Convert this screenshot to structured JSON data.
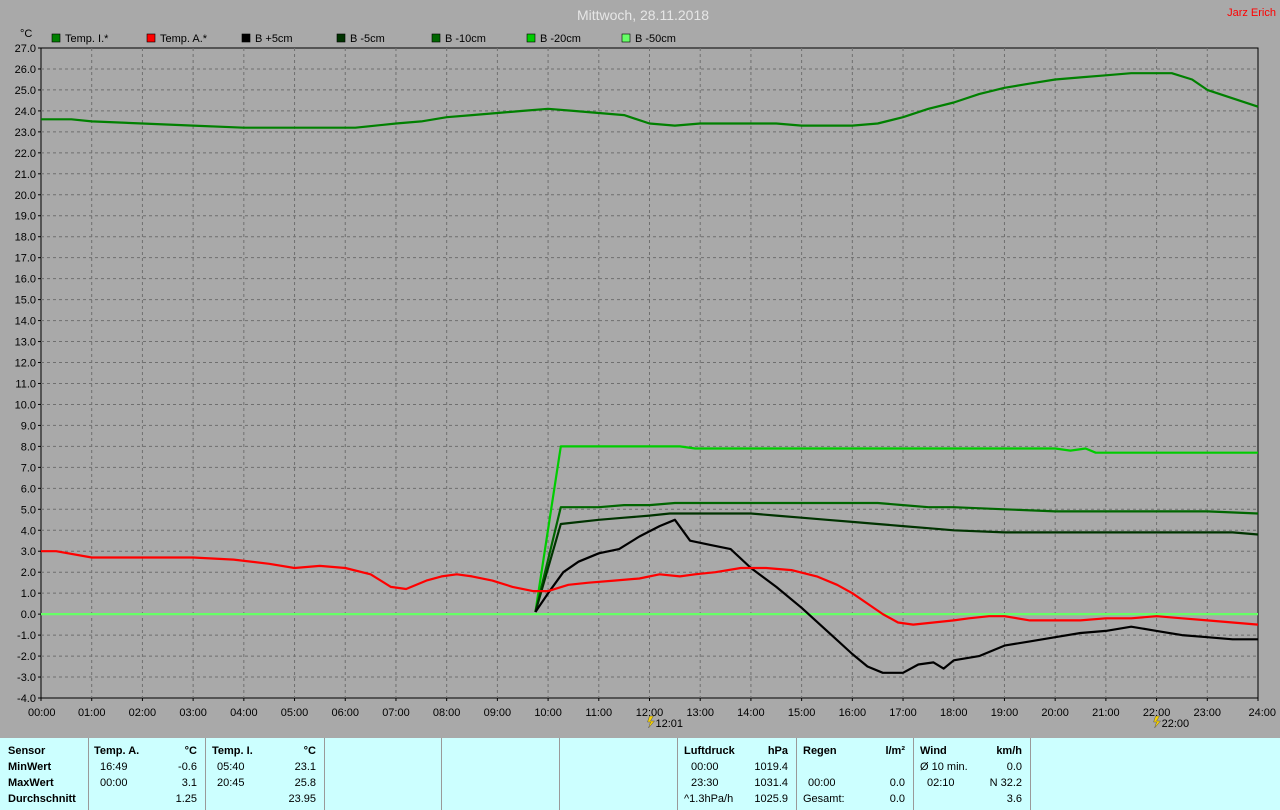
{
  "chart_data": {
    "type": "line",
    "title": "Mittwoch, 28.11.2018",
    "author": "Jarz Erich",
    "ylabel": "°C",
    "ylim": [
      -4,
      27
    ],
    "ytick_step": 1,
    "xlim": [
      0,
      24
    ],
    "x_ticks": [
      "00:00",
      "01:00",
      "02:00",
      "03:00",
      "04:00",
      "05:00",
      "06:00",
      "07:00",
      "08:00",
      "09:00",
      "10:00",
      "11:00",
      "12:00",
      "13:00",
      "14:00",
      "15:00",
      "16:00",
      "17:00",
      "18:00",
      "19:00",
      "20:00",
      "21:00",
      "22:00",
      "23:00",
      "24:00"
    ],
    "grid": true,
    "legend_position": "top",
    "markers": [
      {
        "x": 12.02,
        "label": "12:01",
        "icon": "lightning-icon"
      },
      {
        "x": 22.0,
        "label": "22:00",
        "icon": "lightning-icon"
      }
    ],
    "series": [
      {
        "name": "Temp. I.*",
        "color": "#008000",
        "x": [
          0,
          0.6,
          1,
          2,
          3,
          4,
          5,
          5.8,
          6.2,
          7,
          7.5,
          8,
          8.5,
          9,
          9.5,
          10,
          10.5,
          11,
          11.5,
          12,
          12.5,
          13,
          13.5,
          14,
          14.5,
          15,
          15.5,
          16,
          16.5,
          17,
          17.5,
          18,
          18.5,
          19,
          19.5,
          20,
          20.5,
          21,
          21.5,
          22,
          22.3,
          22.7,
          23,
          23.5,
          24
        ],
        "y": [
          23.6,
          23.6,
          23.5,
          23.4,
          23.3,
          23.2,
          23.2,
          23.2,
          23.2,
          23.4,
          23.5,
          23.7,
          23.8,
          23.9,
          24.0,
          24.1,
          24.0,
          23.9,
          23.8,
          23.4,
          23.3,
          23.4,
          23.4,
          23.4,
          23.4,
          23.3,
          23.3,
          23.3,
          23.4,
          23.7,
          24.1,
          24.4,
          24.8,
          25.1,
          25.3,
          25.5,
          25.6,
          25.7,
          25.8,
          25.8,
          25.8,
          25.5,
          25.0,
          24.6,
          24.2
        ]
      },
      {
        "name": "Temp. A.*",
        "color": "#ff0000",
        "x": [
          0,
          0.3,
          1,
          2,
          3,
          3.8,
          4.5,
          5,
          5.5,
          6,
          6.5,
          6.9,
          7.2,
          7.6,
          7.9,
          8.2,
          8.5,
          8.9,
          9.3,
          9.7,
          10,
          10.4,
          10.8,
          11.3,
          11.8,
          12.2,
          12.6,
          12.9,
          13.3,
          13.8,
          14.3,
          14.8,
          15.3,
          15.7,
          16,
          16.3,
          16.6,
          16.9,
          17.2,
          17.6,
          18,
          18.3,
          18.7,
          19,
          19.5,
          20,
          20.5,
          21,
          21.5,
          22,
          22.5,
          23,
          23.5,
          24
        ],
        "y": [
          3.0,
          3.0,
          2.7,
          2.7,
          2.7,
          2.6,
          2.4,
          2.2,
          2.3,
          2.2,
          1.9,
          1.3,
          1.2,
          1.6,
          1.8,
          1.9,
          1.8,
          1.6,
          1.3,
          1.1,
          1.1,
          1.4,
          1.5,
          1.6,
          1.7,
          1.9,
          1.8,
          1.9,
          2.0,
          2.2,
          2.2,
          2.1,
          1.8,
          1.4,
          1.0,
          0.5,
          0.0,
          -0.4,
          -0.5,
          -0.4,
          -0.3,
          -0.2,
          -0.1,
          -0.1,
          -0.3,
          -0.3,
          -0.3,
          -0.2,
          -0.2,
          -0.1,
          -0.2,
          -0.3,
          -0.4,
          -0.5
        ]
      },
      {
        "name": "B +5cm",
        "color": "#000000",
        "x": [
          9.75,
          10,
          10.3,
          10.6,
          11,
          11.4,
          11.8,
          12.2,
          12.5,
          12.8,
          13.2,
          13.6,
          14,
          14.5,
          15,
          15.5,
          16,
          16.3,
          16.6,
          17,
          17.3,
          17.6,
          17.8,
          18,
          18.5,
          19,
          19.5,
          20,
          20.5,
          21,
          21.5,
          22,
          22.5,
          23,
          23.5,
          24
        ],
        "y": [
          0.1,
          1.0,
          2.0,
          2.5,
          2.9,
          3.1,
          3.7,
          4.2,
          4.5,
          3.5,
          3.3,
          3.1,
          2.2,
          1.3,
          0.3,
          -0.8,
          -1.9,
          -2.5,
          -2.8,
          -2.8,
          -2.4,
          -2.3,
          -2.6,
          -2.2,
          -2.0,
          -1.5,
          -1.3,
          -1.1,
          -0.9,
          -0.8,
          -0.6,
          -0.8,
          -1.0,
          -1.1,
          -1.2,
          -1.2
        ]
      },
      {
        "name": "B -5cm",
        "color": "#003300",
        "x": [
          9.75,
          10.25,
          11,
          11.5,
          12,
          12.4,
          13,
          14,
          14.5,
          15,
          15.5,
          16,
          16.5,
          17,
          17.5,
          18,
          19,
          20,
          21,
          22,
          22.5,
          23,
          23.5,
          24
        ],
        "y": [
          0.1,
          4.3,
          4.5,
          4.6,
          4.7,
          4.8,
          4.8,
          4.8,
          4.7,
          4.6,
          4.5,
          4.4,
          4.3,
          4.2,
          4.1,
          4.0,
          3.9,
          3.9,
          3.9,
          3.9,
          3.9,
          3.9,
          3.9,
          3.8
        ]
      },
      {
        "name": "B -10cm",
        "color": "#006600",
        "x": [
          9.75,
          10.25,
          11,
          11.5,
          12,
          12.5,
          13,
          14,
          15,
          16,
          16.5,
          17,
          17.5,
          18,
          19,
          20,
          21,
          22,
          23,
          24
        ],
        "y": [
          0.1,
          5.1,
          5.1,
          5.2,
          5.2,
          5.3,
          5.3,
          5.3,
          5.3,
          5.3,
          5.3,
          5.2,
          5.1,
          5.1,
          5.0,
          4.9,
          4.9,
          4.9,
          4.9,
          4.8
        ]
      },
      {
        "name": "B -20cm",
        "color": "#00cc00",
        "x": [
          9.75,
          10.25,
          11,
          12,
          12.6,
          12.9,
          13.5,
          14,
          16,
          18,
          20,
          20.3,
          20.6,
          20.8,
          21,
          22,
          23,
          24
        ],
        "y": [
          0.1,
          8.0,
          8.0,
          8.0,
          8.0,
          7.9,
          7.9,
          7.9,
          7.9,
          7.9,
          7.9,
          7.8,
          7.9,
          7.7,
          7.7,
          7.7,
          7.7,
          7.7
        ]
      },
      {
        "name": "B -50cm",
        "color": "#66ff66",
        "x": [
          0,
          24
        ],
        "y": [
          0.0,
          0.0
        ]
      }
    ]
  },
  "stats": {
    "sensor": {
      "header": "Sensor",
      "rows": [
        "MinWert",
        "MaxWert",
        "Durchschnitt"
      ]
    },
    "temp_a": {
      "header": "Temp. A.",
      "unit": "°C",
      "rows": [
        [
          "16:49",
          "-0.6"
        ],
        [
          "00:00",
          "3.1"
        ],
        [
          "",
          "1.25"
        ]
      ]
    },
    "temp_i": {
      "header": "Temp. I.",
      "unit": "°C",
      "rows": [
        [
          "05:40",
          "23.1"
        ],
        [
          "20:45",
          "25.8"
        ],
        [
          "",
          "23.95"
        ]
      ]
    },
    "luftdruck": {
      "header": "Luftdruck",
      "unit": "hPa",
      "rows": [
        [
          "00:00",
          "1019.4"
        ],
        [
          "23:30",
          "1031.4"
        ],
        [
          "^1.3hPa/h",
          "1025.9"
        ]
      ]
    },
    "regen": {
      "header": "Regen",
      "unit": "l/m²",
      "rows": [
        [
          "",
          ""
        ],
        [
          "00:00",
          "0.0"
        ],
        [
          "Gesamt:",
          "0.0"
        ]
      ]
    },
    "wind": {
      "header": "Wind",
      "unit": "km/h",
      "rows": [
        [
          "Ø 10 min.",
          "0.0"
        ],
        [
          "02:10",
          "N 32.2"
        ],
        [
          "",
          "3.6"
        ]
      ]
    }
  }
}
